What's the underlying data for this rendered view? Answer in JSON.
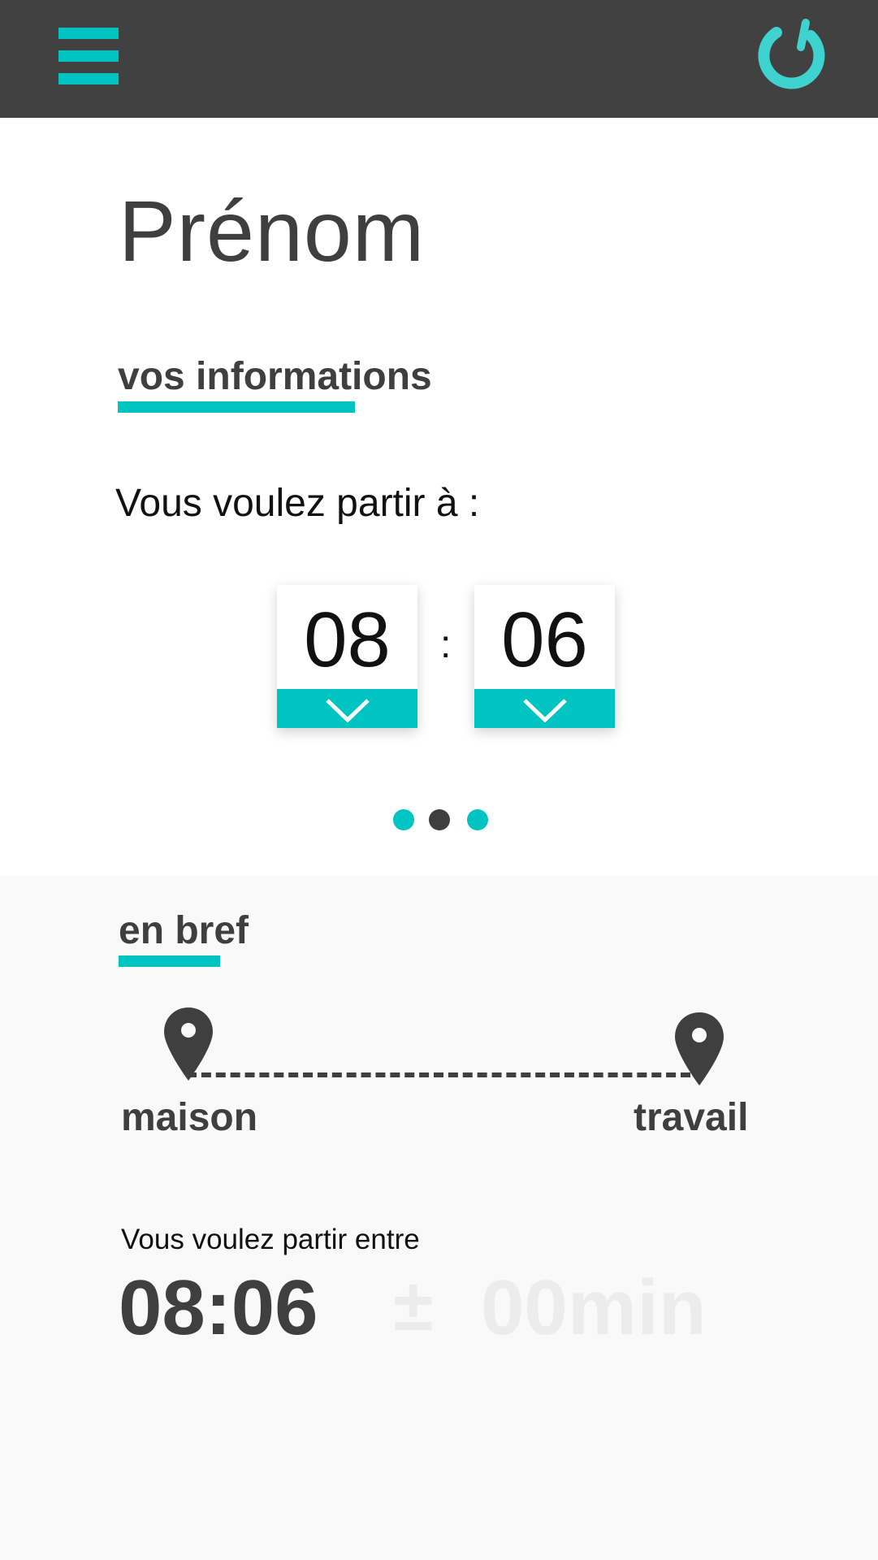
{
  "colors": {
    "header_bg": "#414141",
    "accent": "#00c4c2",
    "text_dark": "#3f3f3f",
    "summary_bg": "#f9f9f9",
    "muted": "#ececec"
  },
  "header": {
    "menu_icon": "hamburger-menu-icon",
    "power_icon": "power-icon"
  },
  "page": {
    "title": "Prénom"
  },
  "info": {
    "heading": "vos informations",
    "prompt": "Vous voulez partir à :",
    "hour": "08",
    "separator": ":",
    "minute": "06",
    "dropdown_icon": "chevron-down-icon"
  },
  "pager": {
    "dots": [
      {
        "color": "#00c4c2"
      },
      {
        "color": "#3f3f3f"
      },
      {
        "color": "#00c4c2"
      }
    ]
  },
  "summary": {
    "heading": "en bref",
    "origin_label": "maison",
    "destination_label": "travail",
    "pin_icon": "map-pin-icon",
    "range_intro": "Vous voulez partir entre",
    "range_time": "08:06",
    "plus_minus": "±",
    "range_duration": "00min"
  }
}
